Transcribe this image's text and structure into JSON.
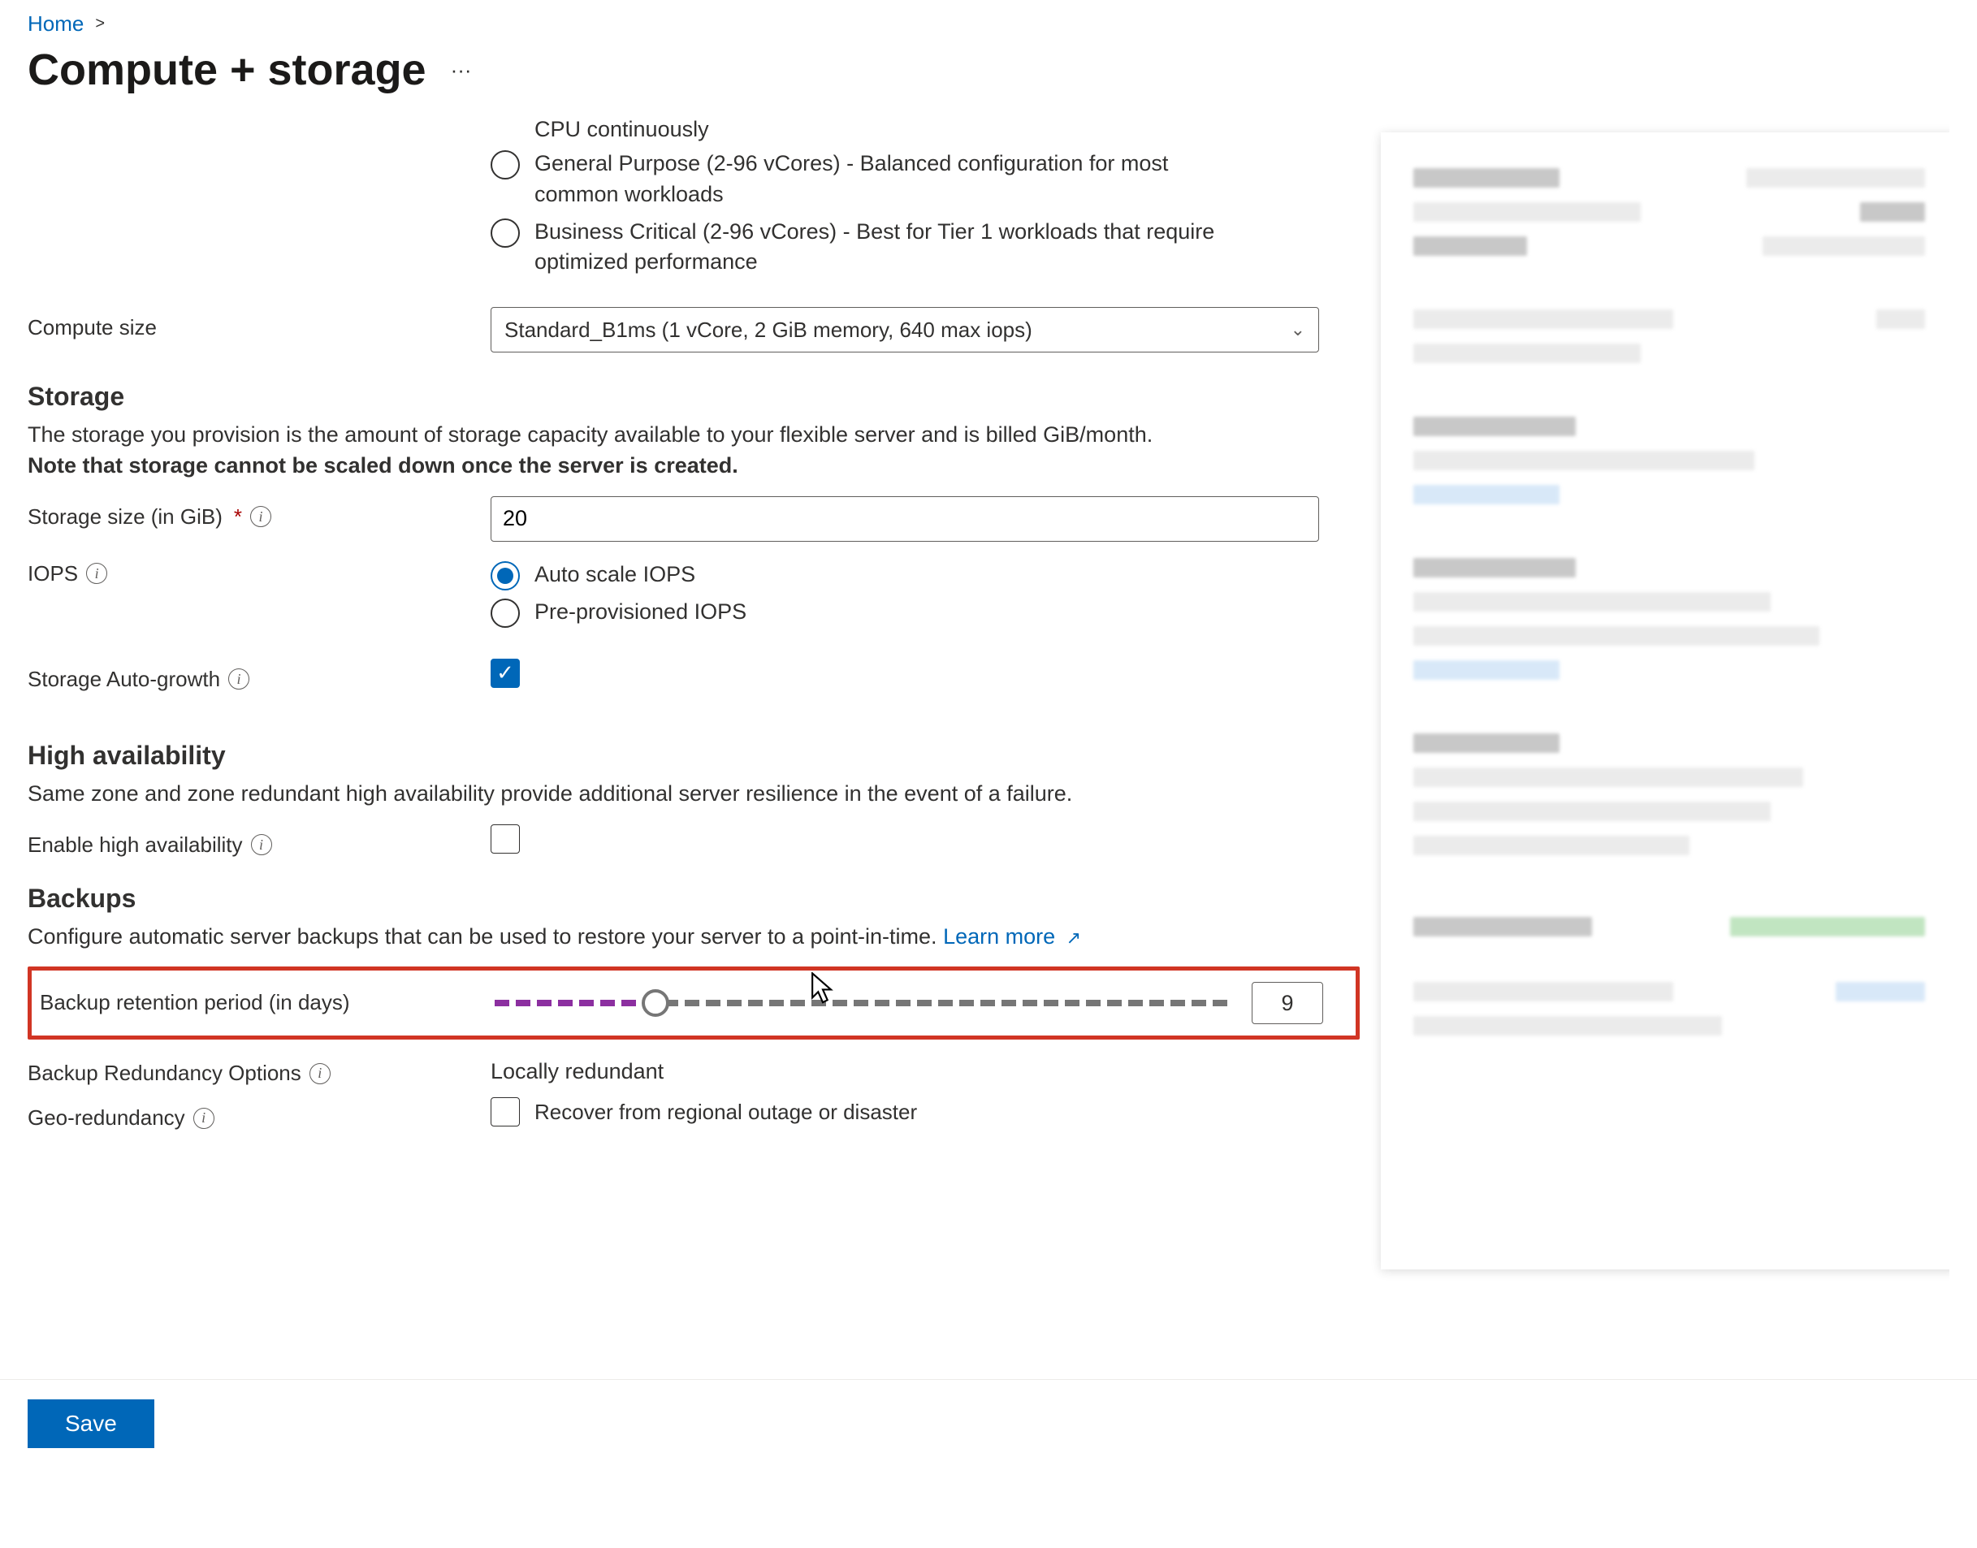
{
  "breadcrumb": {
    "home": "Home",
    "chevron": ">"
  },
  "page": {
    "title": "Compute + storage",
    "more": "···"
  },
  "tier": {
    "clipped_prev_line": "CPU continuously",
    "options": [
      {
        "label": "General Purpose (2-96 vCores) - Balanced configuration for most common workloads"
      },
      {
        "label": "Business Critical (2-96 vCores) - Best for Tier 1 workloads that require optimized performance"
      }
    ]
  },
  "compute_size": {
    "label": "Compute size",
    "selected": "Standard_B1ms (1 vCore, 2 GiB memory, 640 max iops)"
  },
  "storage": {
    "heading": "Storage",
    "description_line1": "The storage you provision is the amount of storage capacity available to your flexible server and is billed GiB/month.",
    "description_line2": "Note that storage cannot be scaled down once the server is created.",
    "size_label": "Storage size (in GiB)",
    "size_value": "20",
    "iops_label": "IOPS",
    "iops_auto": "Auto scale IOPS",
    "iops_pre": "Pre-provisioned IOPS",
    "autogrow_label": "Storage Auto-growth"
  },
  "ha": {
    "heading": "High availability",
    "description": "Same zone and zone redundant high availability provide additional server resilience in the event of a failure.",
    "enable_label": "Enable high availability"
  },
  "backups": {
    "heading": "Backups",
    "description": "Configure automatic server backups that can be used to restore your server to a point-in-time.",
    "learn_more": "Learn more",
    "retention_label": "Backup retention period (in days)",
    "retention_value": "9",
    "redundancy_label": "Backup Redundancy Options",
    "redundancy_value": "Locally redundant",
    "geo_label": "Geo-redundancy",
    "geo_option": "Recover from regional outage or disaster"
  },
  "buttons": {
    "save": "Save"
  },
  "slider_percent": 22
}
